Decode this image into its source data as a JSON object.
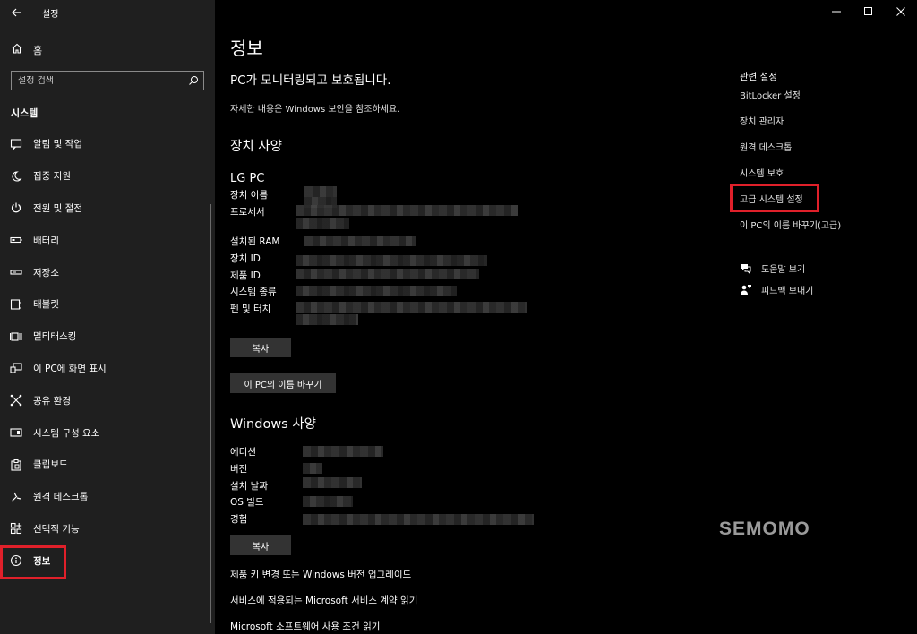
{
  "app": {
    "title": "설정"
  },
  "sidebar": {
    "home_label": "홈",
    "search_placeholder": "설정 검색",
    "section_title": "시스템",
    "items": [
      {
        "label": "알림 및 작업",
        "icon": "notification-icon"
      },
      {
        "label": "집중 지원",
        "icon": "moon-icon"
      },
      {
        "label": "전원 및 절전",
        "icon": "power-icon"
      },
      {
        "label": "배터리",
        "icon": "battery-icon"
      },
      {
        "label": "저장소",
        "icon": "storage-icon"
      },
      {
        "label": "태블릿",
        "icon": "tablet-icon"
      },
      {
        "label": "멀티태스킹",
        "icon": "multitasking-icon"
      },
      {
        "label": "이 PC에 화면 표시",
        "icon": "project-icon"
      },
      {
        "label": "공유 환경",
        "icon": "share-icon"
      },
      {
        "label": "시스템 구성 요소",
        "icon": "components-icon"
      },
      {
        "label": "클립보드",
        "icon": "clipboard-icon"
      },
      {
        "label": "원격 데스크톱",
        "icon": "remote-desktop-icon"
      },
      {
        "label": "선택적 기능",
        "icon": "features-icon"
      },
      {
        "label": "정보",
        "icon": "info-icon",
        "active": true
      }
    ]
  },
  "main": {
    "title": "정보",
    "protect_heading": "PC가 모니터링되고 보호됩니다.",
    "protect_desc": "자세한 내용은 Windows 보안을 참조하세요.",
    "device_specs": {
      "heading": "장치 사양",
      "device_name": "LG PC",
      "labels": [
        "장치 이름",
        "프로세서",
        "설치된 RAM",
        "장치 ID",
        "제품 ID",
        "시스템 종류",
        "펜 및 터치"
      ],
      "copy_label": "복사",
      "rename_label": "이 PC의 이름 바꾸기"
    },
    "windows_specs": {
      "heading": "Windows 사양",
      "labels": [
        "에디션",
        "버전",
        "설치 날짜",
        "OS 빌드",
        "경험"
      ],
      "copy_label": "복사"
    },
    "links": [
      "제품 키 변경 또는 Windows 버전 업그레이드",
      "서비스에 적용되는 Microsoft 서비스 계약 읽기",
      "Microsoft 소프트웨어 사용 조건 읽기"
    ]
  },
  "related": {
    "title": "관련 설정",
    "links": [
      "BitLocker 설정",
      "장치 관리자",
      "원격 데스크톱",
      "시스템 보호",
      "고급 시스템 설정",
      "이 PC의 이름 바꾸기(고급)"
    ],
    "help_label": "도움말 보기",
    "feedback_label": "피드백 보내기"
  },
  "watermark": "SEMOMO",
  "colors": {
    "highlight": "#e0202a",
    "sidebar_bg": "#1f1f1f",
    "main_bg": "#000000",
    "button_bg": "#333333"
  }
}
